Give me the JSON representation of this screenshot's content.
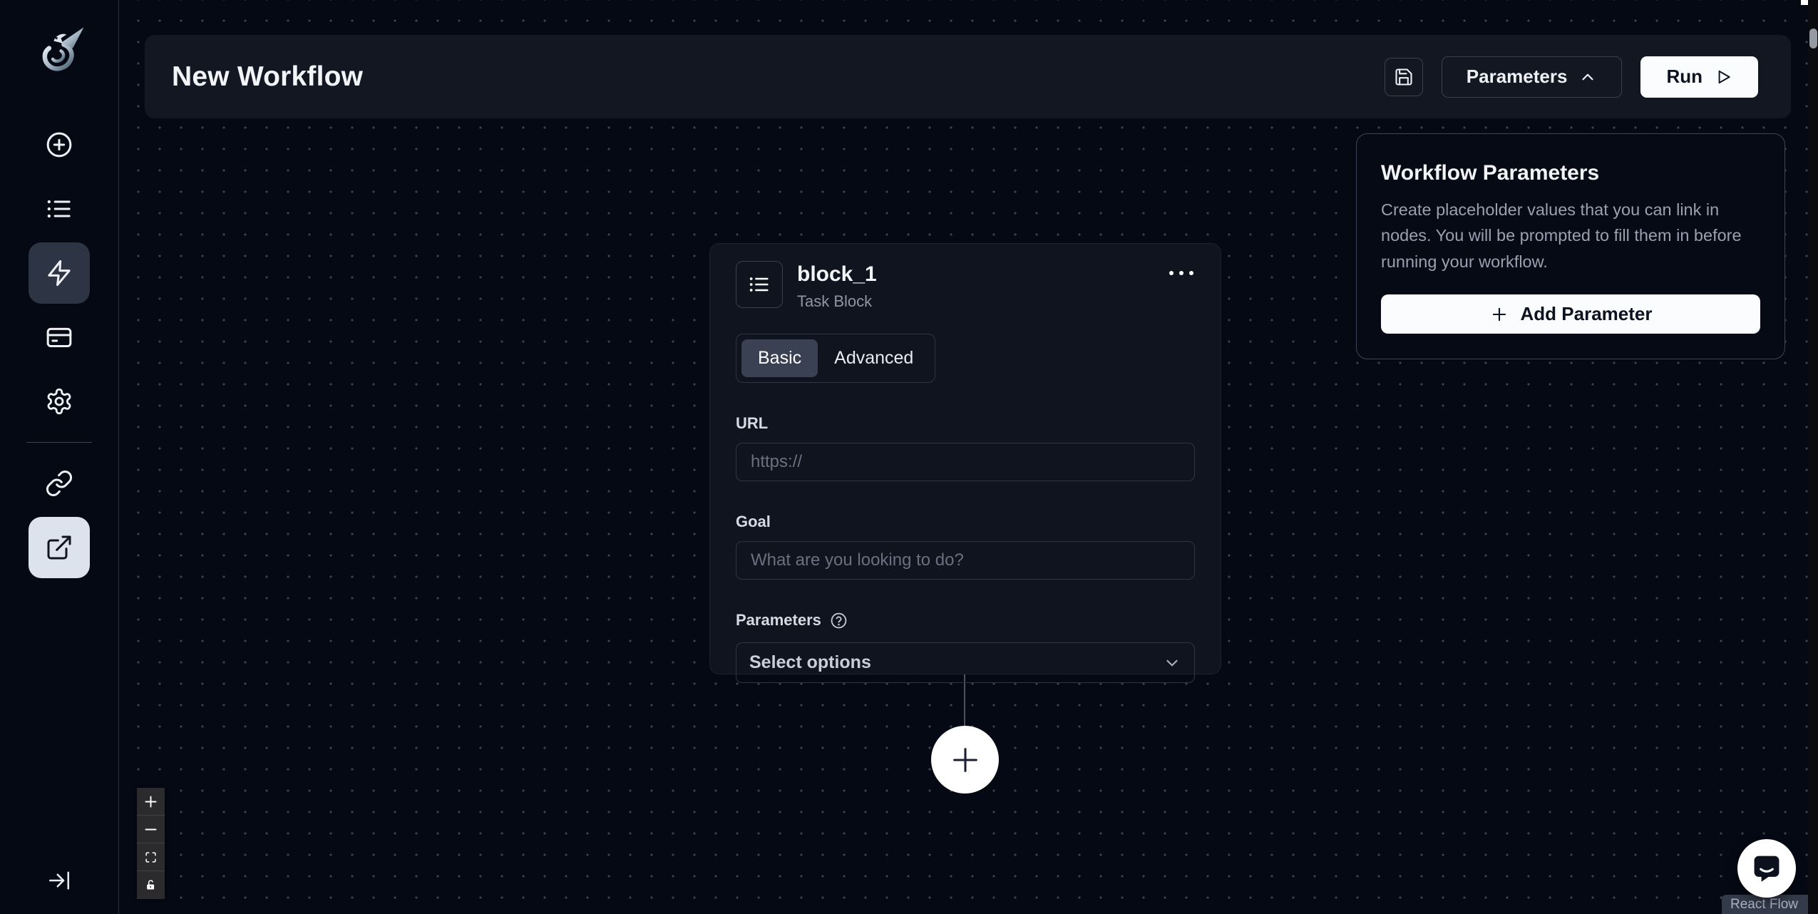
{
  "colors": {
    "canvas_bg": "#050914",
    "panel_bg": "#121722",
    "node_bg": "#10141f",
    "accent_light_button": "#dde3ec",
    "white_button": "#fbfcfd",
    "active_tab": "#394153",
    "text_primary": "#f2f4f8",
    "text_secondary": "#969dac",
    "placeholder": "#69707f",
    "dot_grid": "#3a4150"
  },
  "sidebar": {
    "logo": "skyvern-dragon-logo",
    "items": [
      {
        "icon": "plus-circle-icon",
        "active": false
      },
      {
        "icon": "list-icon",
        "active": false
      },
      {
        "icon": "lightning-icon",
        "active": true
      },
      {
        "icon": "credit-card-icon",
        "active": false
      },
      {
        "icon": "gear-icon",
        "active": false
      },
      {
        "icon": "link-icon",
        "active": false
      },
      {
        "icon": "external-link-icon",
        "highlighted": true
      }
    ],
    "collapse_icon": "arrow-right-to-line-icon"
  },
  "header": {
    "title": "New Workflow",
    "save_button": {
      "icon": "save-icon"
    },
    "parameters_button": {
      "label": "Parameters",
      "icon": "chevron-up-icon"
    },
    "run_button": {
      "label": "Run",
      "icon": "play-icon"
    }
  },
  "node": {
    "icon": "list-icon",
    "title": "block_1",
    "subtitle": "Task Block",
    "menu_icon": "ellipsis-icon",
    "tabs": [
      {
        "label": "Basic",
        "active": true
      },
      {
        "label": "Advanced",
        "active": false
      }
    ],
    "url_field": {
      "label": "URL",
      "value": "",
      "placeholder": "https://"
    },
    "goal_field": {
      "label": "Goal",
      "value": "",
      "placeholder": "What are you looking to do?"
    },
    "parameters_field": {
      "label": "Parameters",
      "help_icon": "question-circle-icon",
      "placeholder": "Select options",
      "chevron": "chevron-down-icon"
    }
  },
  "add_node_button": {
    "icon": "plus-icon"
  },
  "workflow_parameters_panel": {
    "title": "Workflow Parameters",
    "description": "Create placeholder values that you can link in nodes. You will be prompted to fill them in before running your workflow.",
    "add_button": {
      "label": "Add Parameter",
      "icon": "plus-icon"
    }
  },
  "canvas_controls": {
    "zoom_in_icon": "plus-icon",
    "zoom_out_icon": "minus-icon",
    "fit_view_icon": "fit-view-icon",
    "lock_icon": "lock-icon"
  },
  "attribution": "React Flow",
  "chat_button": {
    "icon": "chat-bubble-icon"
  }
}
